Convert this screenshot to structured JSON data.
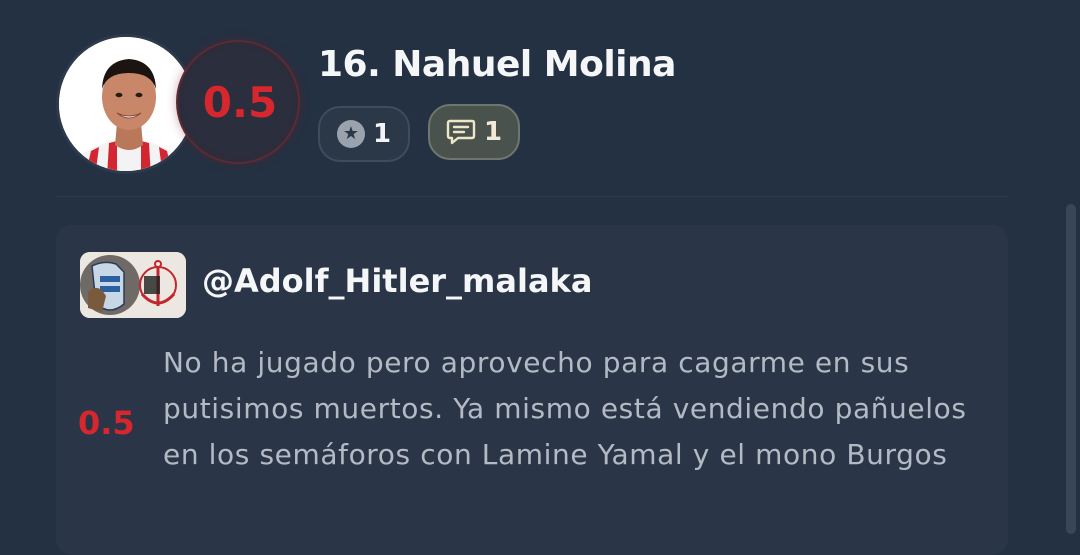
{
  "player": {
    "name": "16. Nahuel Molina",
    "rating": "0.5",
    "stars_count": "1",
    "comments_count": "1"
  },
  "icons": {
    "star": "star-icon",
    "comment": "comment-bubble-icon"
  },
  "comment": {
    "username": "@Adolf_Hitler_malaka",
    "rating": "0.5",
    "text": "No ha jugado pero aprovecho para cagarme en sus putisimos muertos. Ya mismo está vendiendo pañuelos en los semáforos con Lamine Yamal y el mono Burgos"
  },
  "colors": {
    "background": "#233142",
    "card": "#2a3647",
    "rating_red": "#d6262e",
    "comment_text": "#b3bac4"
  }
}
